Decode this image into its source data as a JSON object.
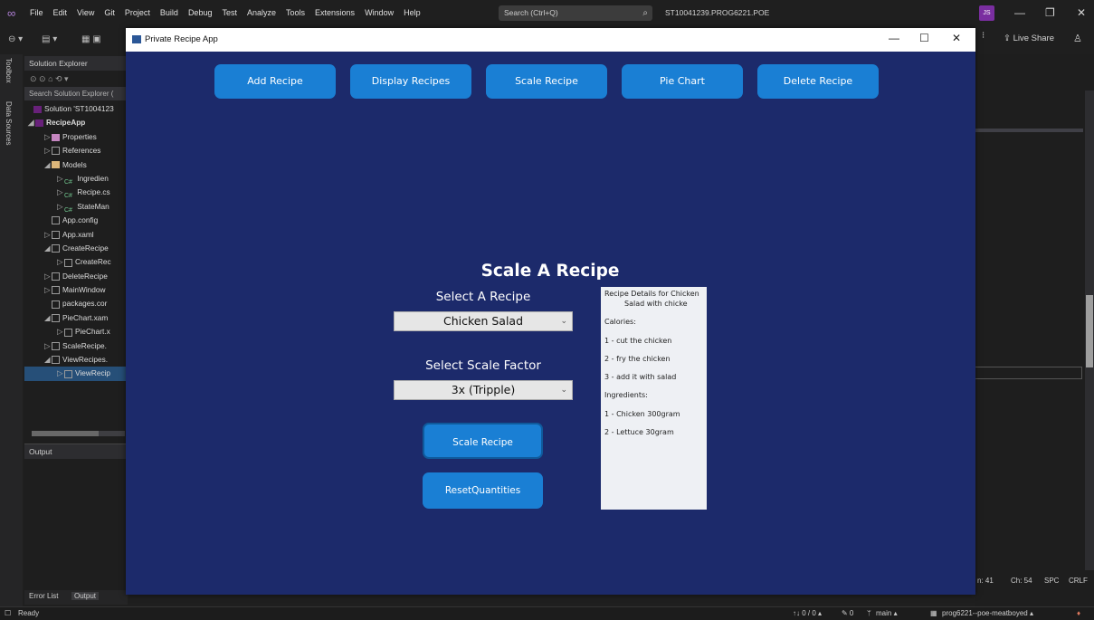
{
  "ide": {
    "menu": [
      "File",
      "Edit",
      "View",
      "Git",
      "Project",
      "Build",
      "Debug",
      "Test",
      "Analyze",
      "Tools",
      "Extensions",
      "Window",
      "Help"
    ],
    "search_placeholder": "Search (Ctrl+Q)",
    "solution_title": "ST10041239.PROG6221.POE",
    "avatar_initials": "JS",
    "live_share": "Live Share",
    "left_tabs": [
      "Toolbox",
      "Data Sources"
    ],
    "solution_explorer": {
      "header": "Solution Explorer",
      "search": "Search Solution Explorer (",
      "items": [
        "Solution 'ST1004123",
        "RecipeApp",
        "Properties",
        "References",
        "Models",
        "Ingredien",
        "Recipe.cs",
        "StateMan",
        "App.config",
        "App.xaml",
        "CreateRecipe",
        "CreateRec",
        "DeleteRecipe",
        "MainWindow",
        "packages.cor",
        "PieChart.xam",
        "PieChart.x",
        "ScaleRecipe.",
        "ViewRecipes.",
        "ViewRecip"
      ]
    },
    "output_header": "Output",
    "bottom_tabs": [
      "Error List",
      "Output"
    ],
    "editor_status": {
      "ln": "n: 41",
      "ch": "Ch: 54",
      "spc": "SPC",
      "crlf": "CRLF"
    },
    "status": {
      "ready": "Ready",
      "changes": "↑↓ 0 / 0 ▴",
      "pencil": "✎ 0",
      "branch": "main ▴",
      "repo": "prog6221--poe-meatboyed ▴"
    },
    "colors": {
      "app_background": "#1c2a6b",
      "button": "#1a7fd4",
      "ide_background": "#1f1f1f"
    }
  },
  "app": {
    "window_title": "Private Recipe App",
    "nav": [
      "Add Recipe",
      "Display Recipes",
      "Scale Recipe",
      "Pie Chart",
      "Delete Recipe"
    ],
    "heading": "Scale A Recipe",
    "select_recipe_label": "Select A Recipe",
    "selected_recipe": "Chicken Salad",
    "select_scale_label": "Select Scale Factor",
    "selected_scale": "3x (Tripple)",
    "scale_button": "Scale Recipe",
    "reset_button": "ResetQuantities",
    "details": {
      "title_line1": "Recipe Details for Chicken",
      "title_line2": "Salad with chicke",
      "calories": "Calories:",
      "steps": [
        "1 - cut the chicken",
        "2 - fry the chicken",
        "3 - add it with salad"
      ],
      "ingredients_label": "Ingredients:",
      "ingredients": [
        "1 - Chicken 300gram",
        "2 - Lettuce 30gram"
      ]
    }
  }
}
